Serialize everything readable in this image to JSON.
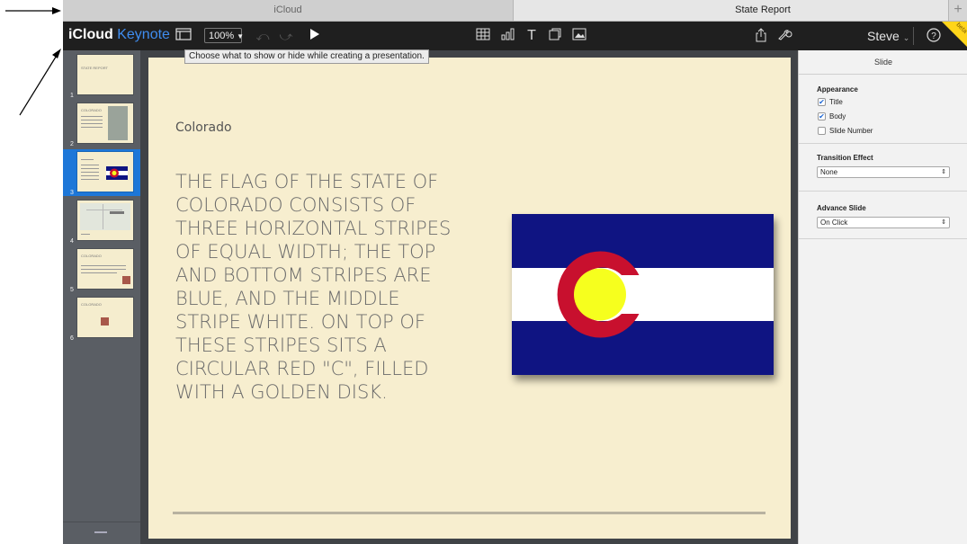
{
  "browser": {
    "tabs": [
      {
        "label": "iCloud"
      },
      {
        "label": "State Report"
      }
    ],
    "new_tab": "+"
  },
  "toolbar": {
    "app_name": "iCloud",
    "app_sub": "Keynote",
    "zoom": "100%",
    "user": "Steve",
    "beta": "beta",
    "tooltip": "Choose what to show or hide while creating a presentation.",
    "icons": [
      "view-options-icon",
      "undo-icon",
      "redo-icon",
      "play-icon",
      "table-icon",
      "chart-icon",
      "text-icon",
      "shape-icon",
      "media-icon",
      "share-icon",
      "tools-icon",
      "help-icon"
    ]
  },
  "navigator": {
    "slides": [
      {
        "number": "1",
        "selected": false
      },
      {
        "number": "2",
        "selected": false
      },
      {
        "number": "3",
        "selected": true
      },
      {
        "number": "4",
        "selected": false
      },
      {
        "number": "5",
        "selected": false
      },
      {
        "number": "6",
        "selected": false
      }
    ]
  },
  "slide": {
    "title": "Colorado",
    "body": "THE FLAG OF THE STATE OF COLORADO CONSISTS OF THREE HORIZONTAL STRIPES OF EQUAL WIDTH; THE TOP AND BOTTOM STRIPES ARE BLUE, AND THE MIDDLE STRIPE WHITE. ON TOP OF THESE STRIPES SITS A CIRCULAR RED \"C\", FILLED WITH A GOLDEN DISK.",
    "colors": {
      "blue": "#0f1482",
      "white": "#ffffff",
      "red": "#c8102e",
      "gold": "#f6ff1e"
    }
  },
  "inspector": {
    "header": "Slide",
    "appearance": {
      "title": "Appearance",
      "options": [
        {
          "label": "Title",
          "checked": true
        },
        {
          "label": "Body",
          "checked": true
        },
        {
          "label": "Slide Number",
          "checked": false
        }
      ]
    },
    "transition": {
      "title": "Transition Effect",
      "value": "None"
    },
    "advance": {
      "title": "Advance Slide",
      "value": "On Click"
    }
  }
}
